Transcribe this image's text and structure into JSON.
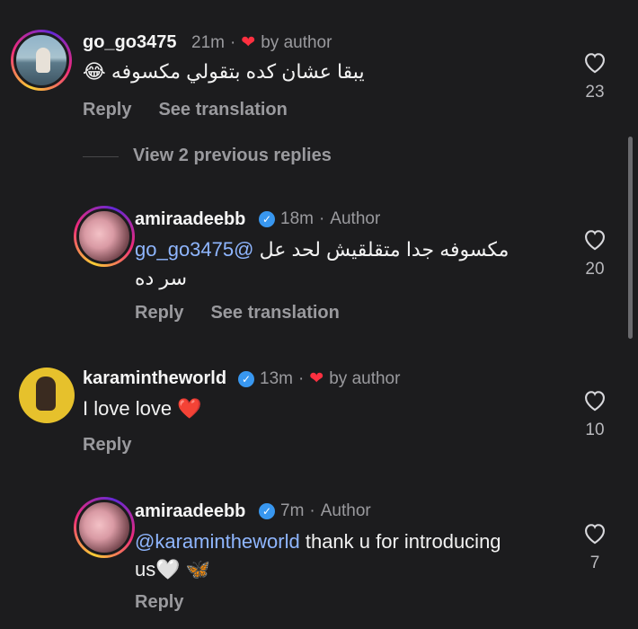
{
  "comments": [
    {
      "username": "go_go3475",
      "time": "21m",
      "by_author": "by author",
      "text": "😂 يبقا عشان كده بتقولي مكسوفه",
      "reply_label": "Reply",
      "translate_label": "See translation",
      "likes": "23"
    },
    {
      "username": "amiraadeebb",
      "time": "18m",
      "author_tag": "Author",
      "mention": "@go_go3475",
      "text": "مكسوفه جدا متقلقيش لحد عل",
      "text2": "سر ده",
      "reply_label": "Reply",
      "translate_label": "See translation",
      "likes": "20"
    },
    {
      "username": "karamintheworld",
      "time": "13m",
      "by_author": "by author",
      "text": "I love love ❤️",
      "reply_label": "Reply",
      "likes": "10"
    },
    {
      "username": "amiraadeebb",
      "time": "7m",
      "author_tag": "Author",
      "mention": "@karamintheworld",
      "text": " thank u for introducing",
      "text2": "us🤍 🦋",
      "reply_label": "Reply",
      "likes": "7"
    }
  ],
  "view_replies": "View 2 previous replies",
  "icons": {
    "heart_outline": "heart-outline-icon",
    "heart_filled": "heart-filled-icon",
    "verified": "verified-badge-icon"
  },
  "colors": {
    "background": "#1c1c1e",
    "mention": "#8fb6ff",
    "liked_heart": "#ff3040",
    "verified": "#3897f0"
  }
}
